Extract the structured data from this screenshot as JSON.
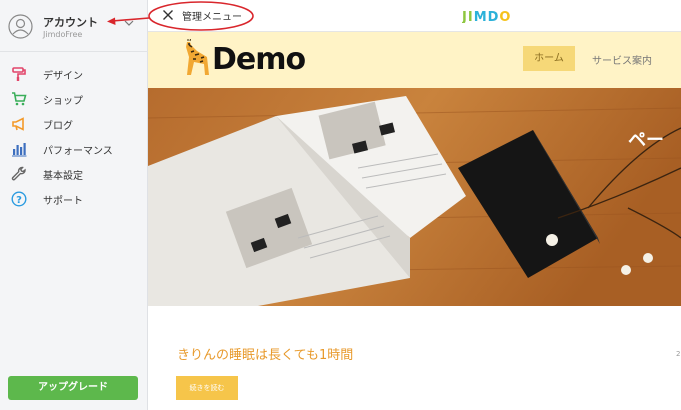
{
  "sidebar": {
    "account": {
      "name": "アカウント",
      "plan": "JimdoFree"
    },
    "items": [
      {
        "label": "デザイン",
        "icon": "paint-roller-icon",
        "color": "#e2456a"
      },
      {
        "label": "ショップ",
        "icon": "shopping-cart-icon",
        "color": "#3aae5a"
      },
      {
        "label": "ブログ",
        "icon": "megaphone-icon",
        "color": "#f39a2a"
      },
      {
        "label": "パフォーマンス",
        "icon": "bar-chart-icon",
        "color": "#3d6fbf"
      },
      {
        "label": "基本設定",
        "icon": "wrench-icon",
        "color": "#777777"
      },
      {
        "label": "サポート",
        "icon": "help-circle-icon",
        "color": "#2b9be0"
      }
    ],
    "upgrade_label": "アップグレード"
  },
  "topbar": {
    "admin_menu_label": "管理メニュー",
    "brand": "JIMDO"
  },
  "site": {
    "logo_text": "Demo",
    "nav": {
      "home": "ホーム",
      "service": "サービス案内"
    },
    "hero_text": "ペー",
    "post_title": "きりんの睡眠は長くても1時間",
    "read_more": "続きを読む",
    "side_number": "2"
  },
  "colors": {
    "accent_green": "#5db84c",
    "header_yellow": "#fff3c6",
    "nav_active": "#f6d878",
    "post_title_orange": "#e89a2c",
    "annotation_red": "#d9262c"
  }
}
